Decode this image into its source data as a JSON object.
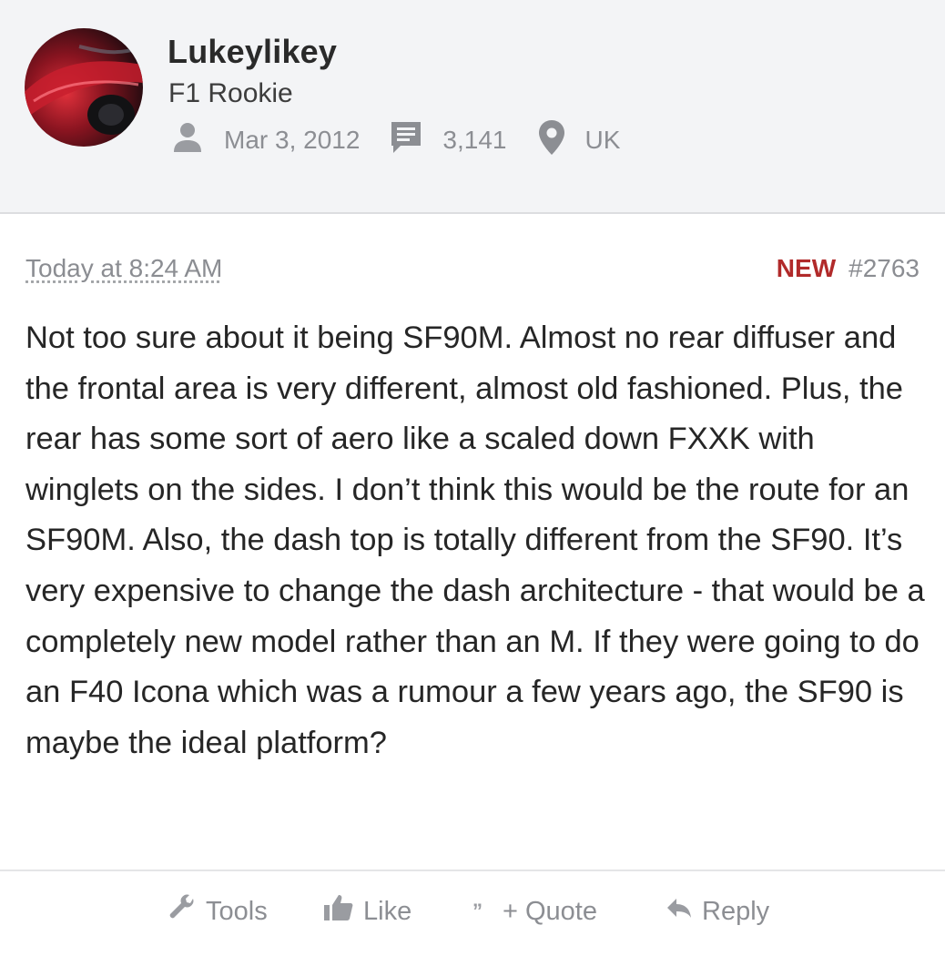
{
  "user": {
    "name": "Lukeylikey",
    "title": "F1 Rookie",
    "joined": "Mar 3, 2012",
    "messages": "3,141",
    "location": "UK"
  },
  "post": {
    "time": "Today at 8:24 AM",
    "badge": "NEW",
    "number": "#2763",
    "body": "Not too sure about it being SF90M. Almost no rear diffuser and the frontal area is very different, almost old fashioned. Plus, the rear has some sort of aero like a scaled down FXXK with winglets on the sides. I don’t think this would be the route for an SF90M. Also, the dash top is totally different from the SF90. It’s very expensive to change the dash architecture - that would be a completely new model rather than an M. If they were going to do an F40 Icona which was a rumour a few years ago, the SF90 is maybe the ideal platform?"
  },
  "actions": {
    "tools": "Tools",
    "like": "Like",
    "quote": "+ Quote",
    "reply": "Reply"
  },
  "icons": {
    "joined": "user-icon",
    "messages": "message-icon",
    "location": "location-pin-icon",
    "tools": "wrench-icon",
    "like": "thumbs-up-icon",
    "quote": "quote-marks-icon",
    "reply": "reply-arrow-icon"
  },
  "colors": {
    "header_bg": "#f3f4f6",
    "new_badge": "#b12a2a",
    "muted_text": "#8c8e93",
    "body_text": "#262626"
  }
}
